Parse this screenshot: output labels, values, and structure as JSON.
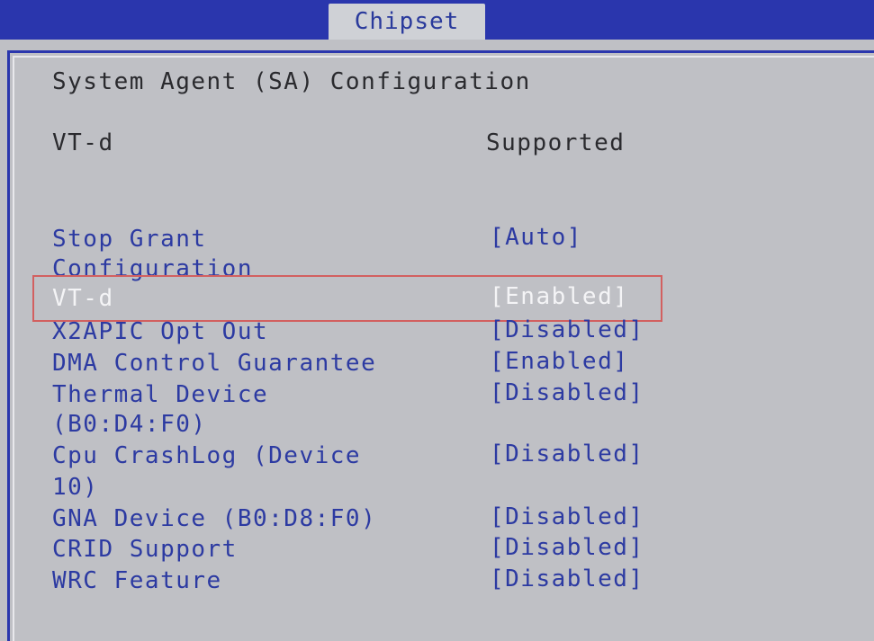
{
  "tabs": {
    "active": "Chipset"
  },
  "page": {
    "title": "System Agent (SA) Configuration"
  },
  "info": {
    "label": "VT-d",
    "value": "Supported"
  },
  "settings": [
    {
      "label_line1": "Stop Grant",
      "label_line2": "Configuration",
      "value": "[Auto]"
    },
    {
      "label_line1": "VT-d",
      "label_line2": "",
      "value": "[Enabled]",
      "selected": true
    },
    {
      "label_line1": "X2APIC Opt Out",
      "label_line2": "",
      "value": "[Disabled]"
    },
    {
      "label_line1": "DMA Control Guarantee",
      "label_line2": "",
      "value": "[Enabled]"
    },
    {
      "label_line1": "Thermal Device",
      "label_line2": "(B0:D4:F0)",
      "value": "[Disabled]"
    },
    {
      "label_line1": "Cpu CrashLog (Device",
      "label_line2": "10)",
      "value": "[Disabled]"
    },
    {
      "label_line1": "GNA Device (B0:D8:F0)",
      "label_line2": "",
      "value": "[Disabled]"
    },
    {
      "label_line1": "CRID Support",
      "label_line2": "",
      "value": "[Disabled]"
    },
    {
      "label_line1": "WRC Feature",
      "label_line2": "",
      "value": "[Disabled]"
    }
  ],
  "colors": {
    "header_blue": "#2d39b0",
    "panel_gray": "#bfc0c5",
    "option_blue": "#2c3aa2",
    "selected_text": "#f4f4f6",
    "highlight_red": "#d26060"
  }
}
